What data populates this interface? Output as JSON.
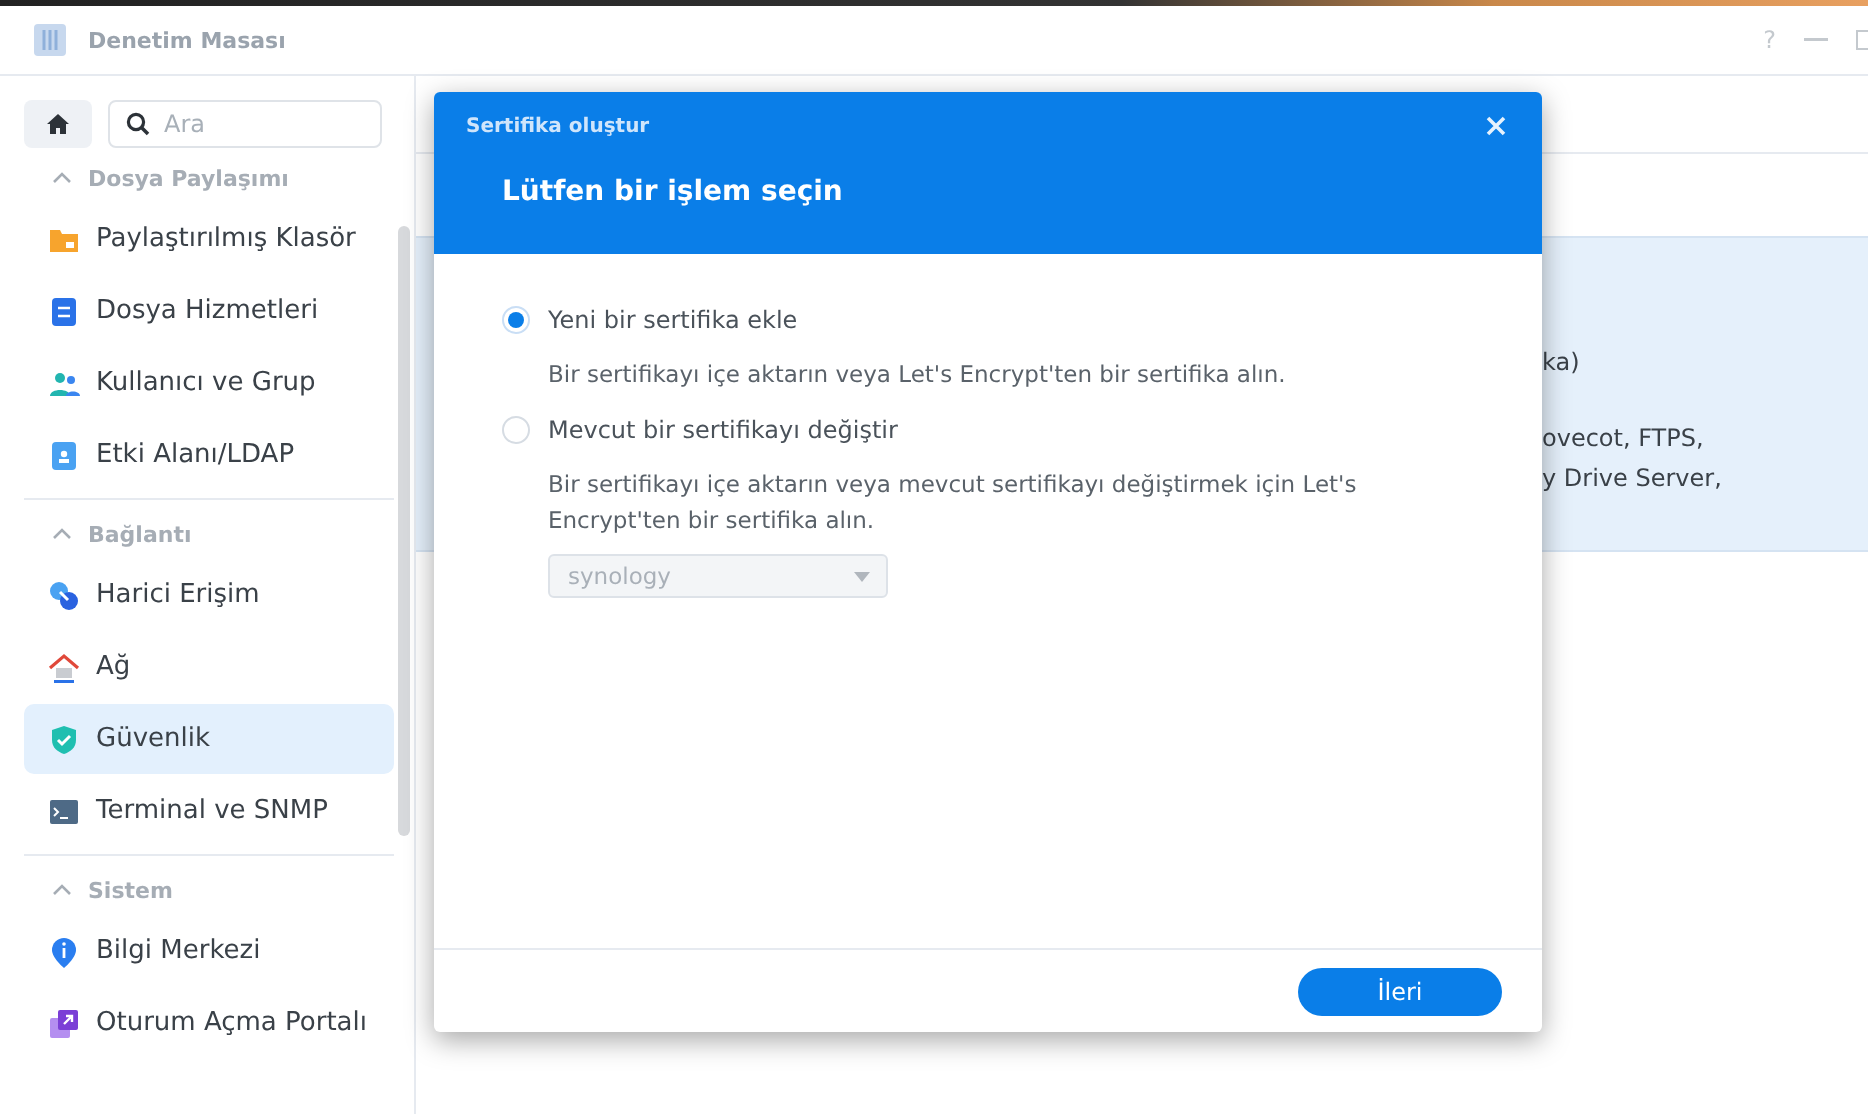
{
  "window": {
    "title": "Denetim Masası",
    "help": "?"
  },
  "sidebar": {
    "search": {
      "placeholder": "Ara"
    },
    "groups": [
      {
        "label": "Dosya Paylaşımı",
        "expanded": true,
        "items": [
          {
            "label": "Paylaştırılmış Klasör",
            "kind": "folder",
            "selected": false
          },
          {
            "label": "Dosya Hizmetleri",
            "kind": "file",
            "selected": false
          },
          {
            "label": "Kullanıcı ve Grup",
            "kind": "users",
            "selected": false
          },
          {
            "label": "Etki Alanı/LDAP",
            "kind": "badge",
            "selected": false
          }
        ]
      },
      {
        "label": "Bağlantı",
        "expanded": true,
        "items": [
          {
            "label": "Harici Erişim",
            "kind": "link",
            "selected": false
          },
          {
            "label": "Ağ",
            "kind": "house",
            "selected": false
          },
          {
            "label": "Güvenlik",
            "kind": "shield",
            "selected": true
          },
          {
            "label": "Terminal ve SNMP",
            "kind": "terminal",
            "selected": false
          }
        ]
      },
      {
        "label": "Sistem",
        "expanded": true,
        "items": [
          {
            "label": "Bilgi Merkezi",
            "kind": "info",
            "selected": false
          },
          {
            "label": "Oturum Açma Portalı",
            "kind": "portal",
            "selected": false
          }
        ]
      }
    ]
  },
  "background_panel": {
    "lines": [
      "ka)",
      "ovecot, FTPS,",
      "y Drive Server,"
    ]
  },
  "dialog": {
    "title": "Sertifika oluştur",
    "heading": "Lütfen bir işlem seçin",
    "options": [
      {
        "label": "Yeni bir sertifika ekle",
        "selected": true,
        "description": "Bir sertifikayı içe aktarın veya Let's Encrypt'ten bir sertifika alın."
      },
      {
        "label": "Mevcut bir sertifikayı değiştir",
        "selected": false,
        "description": "Bir sertifikayı içe aktarın veya mevcut sertifikayı değiştirmek için Let's Encrypt'ten bir sertifika alın.",
        "dropdown": {
          "value": "synology",
          "disabled": true
        }
      }
    ],
    "next_button": "İleri"
  }
}
